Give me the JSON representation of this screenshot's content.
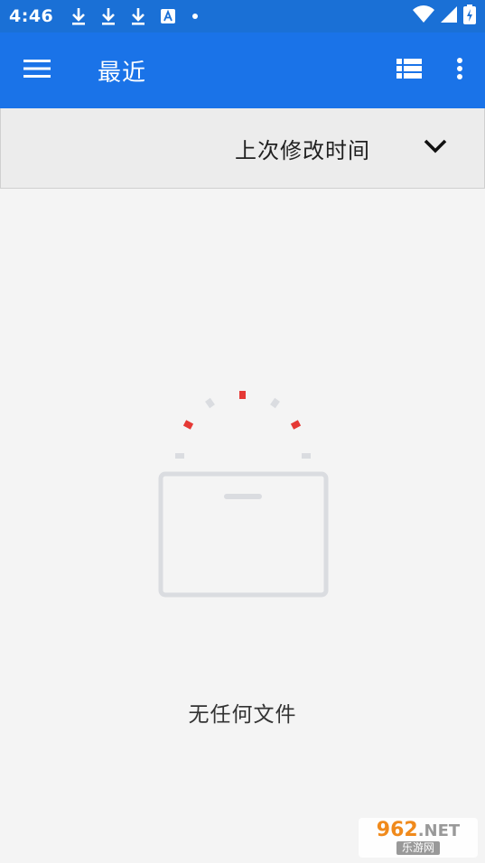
{
  "status_bar": {
    "time": "4:46",
    "icons": [
      "download-icon",
      "download-icon",
      "download-icon",
      "a-badge-icon",
      "dot-icon"
    ],
    "right_icons": [
      "wifi-icon",
      "signal-icon",
      "battery-icon"
    ]
  },
  "app_bar": {
    "title": "最近",
    "menu_icon": "hamburger-menu-icon",
    "actions": [
      "list-view-icon",
      "more-vert-icon"
    ]
  },
  "sort_bar": {
    "label": "上次修改时间",
    "icon": "chevron-down-icon"
  },
  "empty_state": {
    "message": "无任何文件",
    "illustration": "empty-folder-icon"
  },
  "watermark": {
    "brand": "962",
    "suffix": ".NET",
    "subtitle": "乐游网"
  },
  "colors": {
    "status_bar": "#1a70d6",
    "app_bar": "#1a73e8",
    "accent_red": "#e53935",
    "illustration_gray": "#dadce0"
  }
}
